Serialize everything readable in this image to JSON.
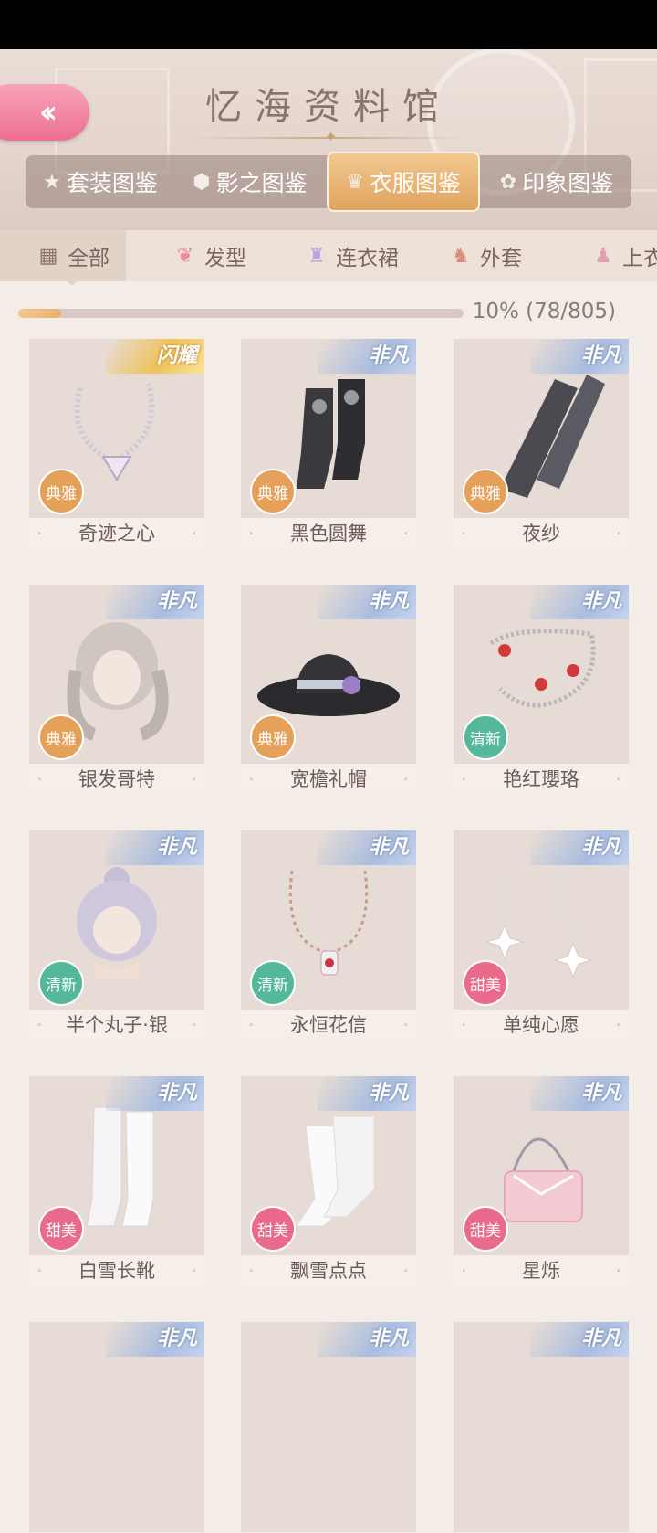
{
  "header": {
    "title": "忆海资料馆",
    "back_icon": "double-chevron-left-icon",
    "tabs": [
      {
        "label": "套装图鉴",
        "icon": "star-icon",
        "active": false
      },
      {
        "label": "影之图鉴",
        "icon": "hexagon-icon",
        "active": false
      },
      {
        "label": "衣服图鉴",
        "icon": "dress-icon",
        "active": true
      },
      {
        "label": "印象图鉴",
        "icon": "flower-icon",
        "active": false
      }
    ]
  },
  "categories": [
    {
      "label": "全部",
      "icon": "grid-icon",
      "active": true
    },
    {
      "label": "发型",
      "icon": "hair-icon",
      "active": false
    },
    {
      "label": "连衣裙",
      "icon": "dress-icon",
      "active": false
    },
    {
      "label": "外套",
      "icon": "coat-icon",
      "active": false
    },
    {
      "label": "上衣",
      "icon": "shirt-icon",
      "active": false
    }
  ],
  "progress": {
    "text": "10% (78/805)",
    "fraction": 0.097
  },
  "colors": {
    "elegant": "#e5a05a",
    "fresh": "#55b89a",
    "sweet": "#ea6a8a",
    "accent": "#e9b06e"
  },
  "items": [
    {
      "name": "奇迹之心",
      "rarity": "闪耀",
      "style": "典雅",
      "style_key": "elegant",
      "kind": "necklace"
    },
    {
      "name": "黑色圆舞",
      "rarity": "非凡",
      "style": "典雅",
      "style_key": "elegant",
      "kind": "boots-black"
    },
    {
      "name": "夜纱",
      "rarity": "非凡",
      "style": "典雅",
      "style_key": "elegant",
      "kind": "stockings"
    },
    {
      "name": "银发哥特",
      "rarity": "非凡",
      "style": "典雅",
      "style_key": "elegant",
      "kind": "hair"
    },
    {
      "name": "宽檐礼帽",
      "rarity": "非凡",
      "style": "典雅",
      "style_key": "elegant",
      "kind": "hat"
    },
    {
      "name": "艳红瓔珞",
      "rarity": "非凡",
      "style": "清新",
      "style_key": "fresh",
      "kind": "necklace-red"
    },
    {
      "name": "半个丸子·银",
      "rarity": "非凡",
      "style": "清新",
      "style_key": "fresh",
      "kind": "hair-bun"
    },
    {
      "name": "永恒花信",
      "rarity": "非凡",
      "style": "清新",
      "style_key": "fresh",
      "kind": "pendant"
    },
    {
      "name": "单纯心愿",
      "rarity": "非凡",
      "style": "甜美",
      "style_key": "sweet",
      "kind": "earrings"
    },
    {
      "name": "白雪长靴",
      "rarity": "非凡",
      "style": "甜美",
      "style_key": "sweet",
      "kind": "boots-white"
    },
    {
      "name": "飘雪点点",
      "rarity": "非凡",
      "style": "甜美",
      "style_key": "sweet",
      "kind": "socks"
    },
    {
      "name": "星烁",
      "rarity": "非凡",
      "style": "甜美",
      "style_key": "sweet",
      "kind": "bag"
    },
    {
      "name": "",
      "rarity": "非凡",
      "style": "",
      "style_key": "",
      "kind": "none"
    },
    {
      "name": "",
      "rarity": "非凡",
      "style": "",
      "style_key": "",
      "kind": "none"
    },
    {
      "name": "",
      "rarity": "非凡",
      "style": "",
      "style_key": "",
      "kind": "none"
    }
  ]
}
